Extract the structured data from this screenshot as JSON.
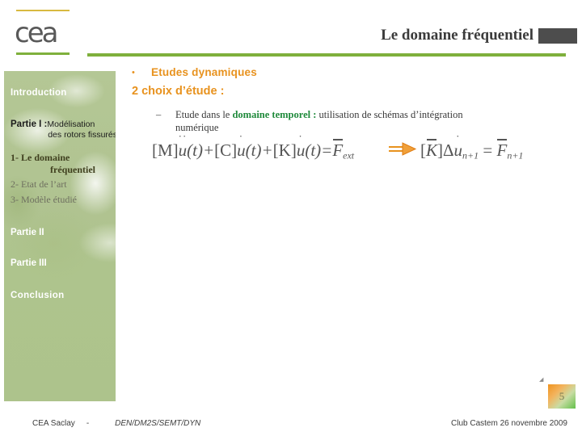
{
  "header": {
    "logo_text": "cea",
    "title": "Le domaine fréquentiel",
    "accent_green": "#7fb03c",
    "accent_gold": "#d8b940",
    "title_block_color": "#4d4d4d"
  },
  "sidebar": {
    "items": [
      {
        "label": "Introduction"
      },
      {
        "label": "Partie I :",
        "detail": "Modélisation",
        "detail2": "des rotors fissurés"
      },
      {
        "label": "1- Le domaine",
        "label2": "fréquentiel"
      },
      {
        "label": "2- Etat de l’art"
      },
      {
        "label": "3- Modèle étudié"
      },
      {
        "label": "Partie II"
      },
      {
        "label": "Partie III"
      },
      {
        "label": "Conclusion"
      }
    ]
  },
  "main": {
    "bullet_marker": "•",
    "bullet_1": "Etudes dynamiques",
    "headline_2": "2 choix d’étude :",
    "dash_marker": "–",
    "sub_bullet_pre": "Etude dans le ",
    "sub_bullet_highlight": "domaine temporel :",
    "sub_bullet_post": " utilisation de schémas d’intégration",
    "sub_bullet_line2": "numérique",
    "highlight_color": "#1f8a3b",
    "accent_orange": "#e8921e",
    "equation_1": "[M]ü(t) + [C]u̇(t) + [K]u(t) = F̄ext",
    "equation_2": "[K̄]Δu̇n+1 = F̄n+1",
    "equation_1_parts": {
      "m_bracket": "[M]",
      "m_var": "u",
      "m_dots": "··",
      "m_arg": "(t)+",
      "c_bracket": "[C]",
      "c_var": "u",
      "c_dots": "·",
      "c_arg": "(t)+",
      "k_bracket": "[K]",
      "k_var": "u",
      "k_dots": "·",
      "k_arg": "(t)=",
      "rhs_var": "F",
      "rhs_sub": "ext"
    },
    "equation_2_parts": {
      "k_bracket_open": "[",
      "k_var": "K",
      "k_bracket_close": "]",
      "delta": "Δ",
      "u_var": "u",
      "u_sub": "n+1",
      "equals": "=",
      "f_var": "F",
      "f_sub": "n+1"
    },
    "arrow_name": "implies-arrow"
  },
  "footer": {
    "site": "CEA Saclay",
    "separator": "-",
    "unit": "DEN/DM2S/SEMT/DYN",
    "event": "Club Castem 26 novembre 2009",
    "slide_number": "5"
  }
}
